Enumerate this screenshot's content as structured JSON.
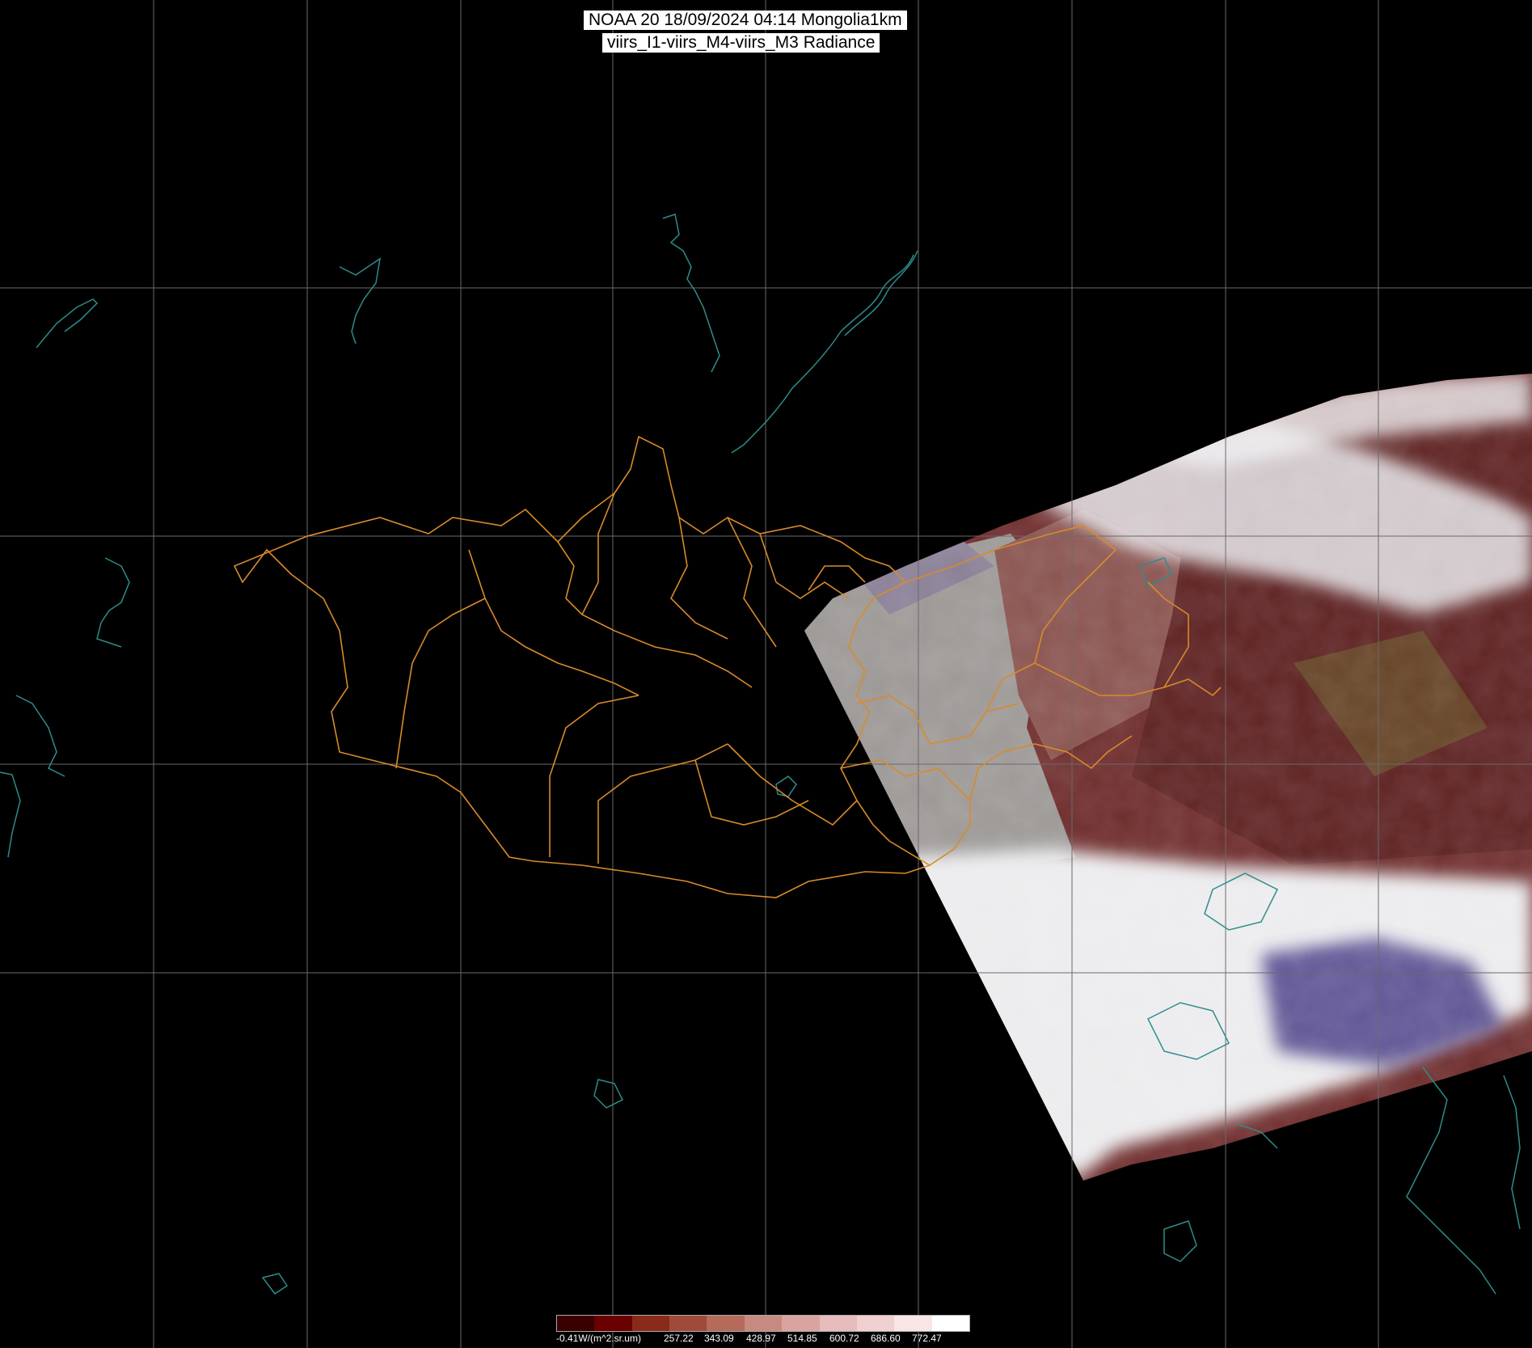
{
  "title": {
    "line1": "NOAA 20 18/09/2024 04:14 Mongolia1km",
    "line2": "viirs_I1-viirs_M4-viirs_M3 Radiance"
  },
  "legend": {
    "min_label": "-0.41W/(m^2.sr.um)",
    "ticks": [
      "257.22",
      "343.09",
      "428.97",
      "514.85",
      "600.72",
      "686.60",
      "772.47"
    ],
    "colors": [
      "#3a0000",
      "#6b0000",
      "#8a2a1a",
      "#a04a3a",
      "#b56a5a",
      "#c78a80",
      "#d9a4a0",
      "#e6bcbc",
      "#f0d0d0",
      "#f8e6e6",
      "#ffffff"
    ]
  },
  "map": {
    "background": "#000000",
    "grid_color": "#6a6a6a",
    "border_color": "#d98a2a",
    "coast_color": "#2e8c8c",
    "swath_colors": {
      "desert": "#9c9a98",
      "cloud": "#e8e8ea",
      "forest": "#6a2a2a",
      "steppe": "#8a5a5a",
      "purple": "#5a4a8a"
    }
  }
}
